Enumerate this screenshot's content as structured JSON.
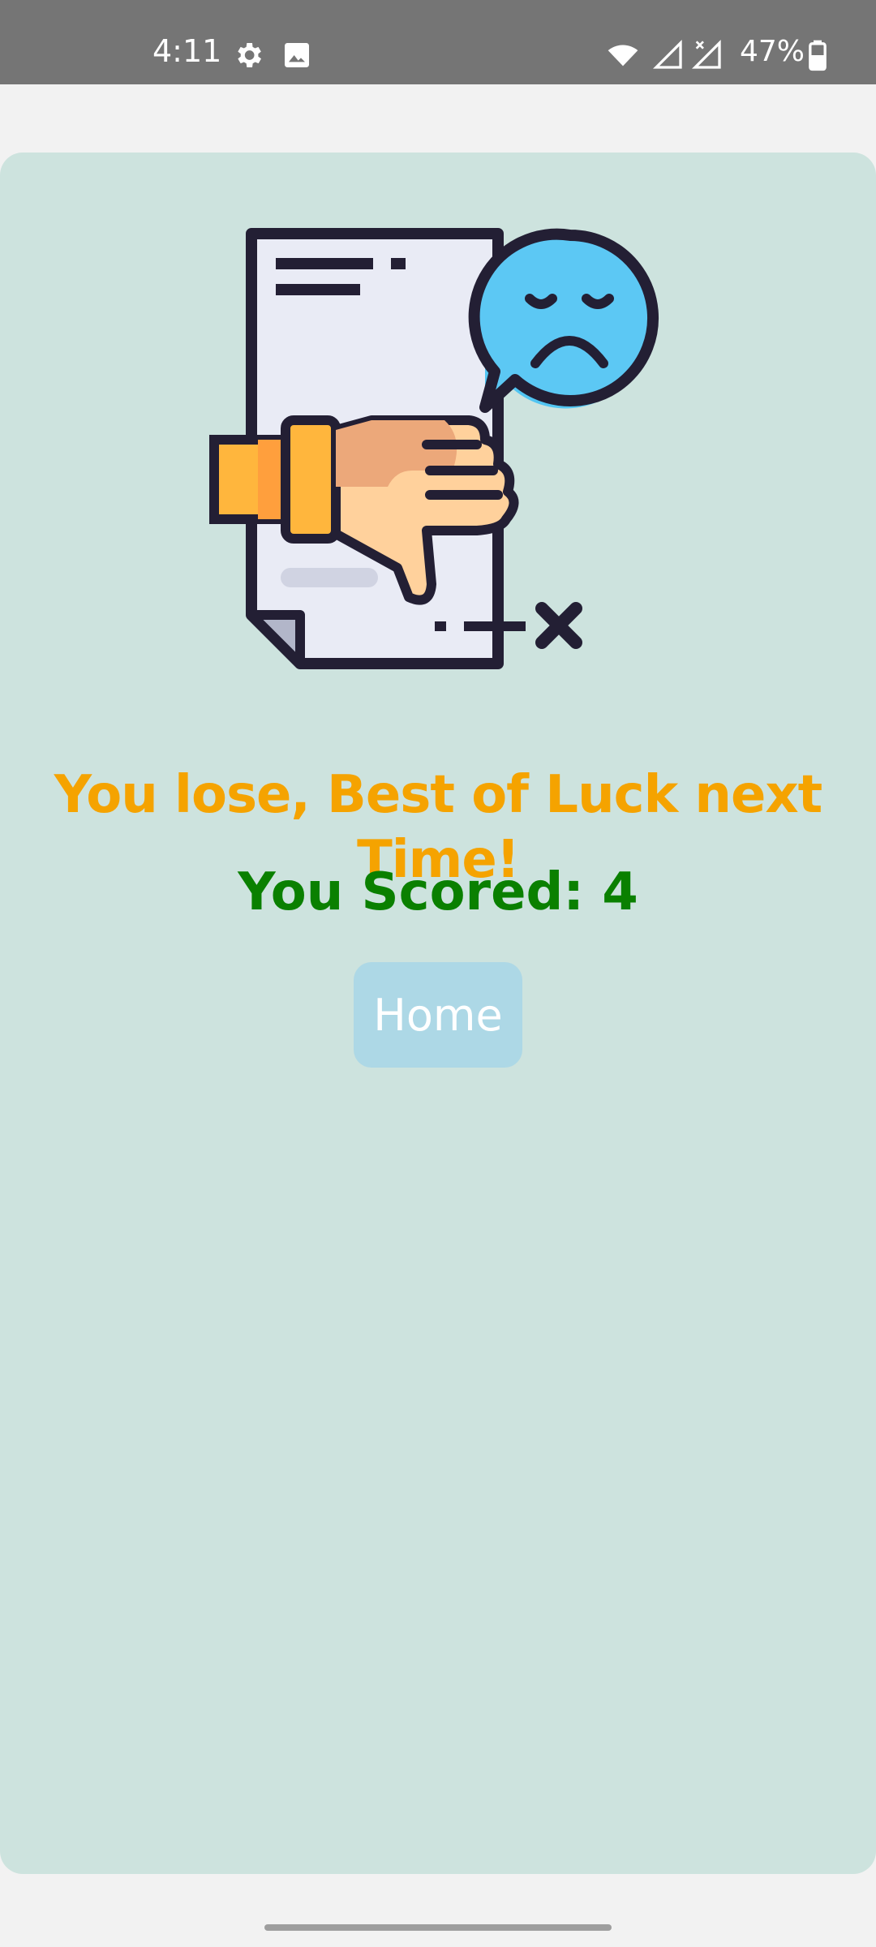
{
  "status_bar": {
    "time": "4:11",
    "battery": "47%",
    "icons": [
      "settings-icon",
      "image-icon",
      "wifi-icon",
      "signal-icon",
      "signal-no-data-icon",
      "battery-icon"
    ]
  },
  "result": {
    "lose_message": "You lose, Best of Luck next Time!",
    "score_text": "You Scored: 4"
  },
  "home_button": {
    "label": "Home"
  },
  "colors": {
    "status_bar_bg": "#757575",
    "card_bg": "#cde3de",
    "lose_text": "#f5a300",
    "score_text": "#0a8000",
    "button_bg": "#add8e6"
  },
  "illustration": "thumbs-down-document-with-sad-face-icon"
}
